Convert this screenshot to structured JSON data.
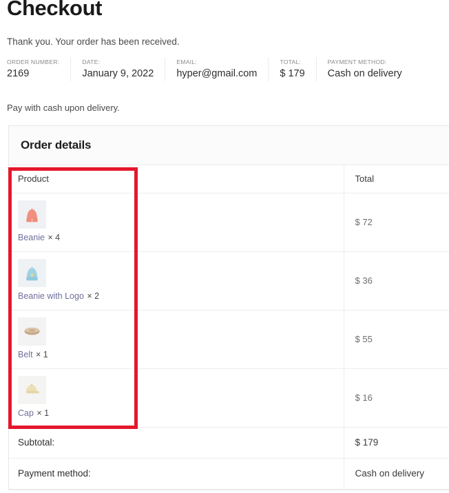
{
  "page": {
    "title": "Checkout",
    "thank_you": "Thank you. Your order has been received.",
    "pay_note": "Pay with cash upon delivery."
  },
  "order_meta": [
    {
      "label": "ORDER NUMBER:",
      "value": "2169"
    },
    {
      "label": "DATE:",
      "value": "January 9, 2022"
    },
    {
      "label": "EMAIL:",
      "value": "hyper@gmail.com"
    },
    {
      "label": "TOTAL:",
      "value": "$ 179"
    },
    {
      "label": "PAYMENT METHOD:",
      "value": "Cash on delivery"
    }
  ],
  "order_details": {
    "heading": "Order details",
    "columns": {
      "product": "Product",
      "total": "Total"
    },
    "items": [
      {
        "name": "Beanie",
        "qty": "× 4",
        "total": "$ 72",
        "icon": "beanie-salmon-thumbnail"
      },
      {
        "name": "Beanie with Logo",
        "qty": "× 2",
        "total": "$ 36",
        "icon": "beanie-blue-logo-thumbnail"
      },
      {
        "name": "Belt",
        "qty": "× 1",
        "total": "$ 55",
        "icon": "belt-tan-thumbnail"
      },
      {
        "name": "Cap",
        "qty": "× 1",
        "total": "$ 16",
        "icon": "cap-cream-thumbnail"
      }
    ],
    "summary": [
      {
        "label": "Subtotal:",
        "value": "$ 179"
      },
      {
        "label": "Payment method:",
        "value": "Cash on delivery"
      }
    ]
  },
  "annotation": {
    "name": "product-column-highlight",
    "color": "#e4182c"
  },
  "colors": {
    "accent_red": "#e4182c",
    "link": "#6f6f9c",
    "text": "#3c3c3c",
    "muted": "#8a8a8a",
    "panel_header_bg": "#fbfbfb",
    "border": "#ededed"
  }
}
